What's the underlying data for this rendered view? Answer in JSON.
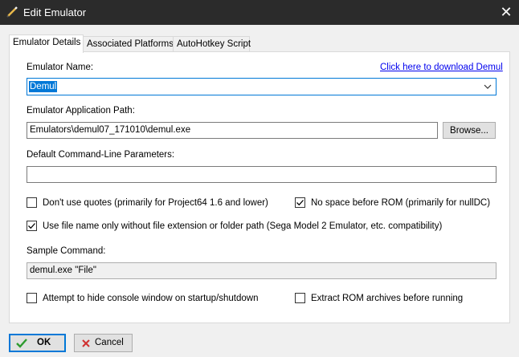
{
  "window": {
    "title": "Edit Emulator",
    "close_glyph": "✕"
  },
  "tabs": [
    {
      "label": "Emulator Details",
      "active": true
    },
    {
      "label": "Associated Platforms",
      "active": false
    },
    {
      "label": "AutoHotkey Script",
      "active": false
    }
  ],
  "details": {
    "name_label": "Emulator Name:",
    "download_link": "Click here to download Demul",
    "name_value": "Demul",
    "path_label": "Emulator Application Path:",
    "path_value": "Emulators\\demul07_171010\\demul.exe",
    "browse_label": "Browse...",
    "params_label": "Default Command-Line Parameters:",
    "params_value": "",
    "options": {
      "no_quotes": {
        "label": "Don't use quotes (primarily for Project64 1.6 and lower)",
        "checked": false
      },
      "no_space": {
        "label": "No space before ROM (primarily for nullDC)",
        "checked": true
      },
      "file_name_only": {
        "label": "Use file name only without file extension or folder path (Sega Model 2 Emulator, etc. compatibility)",
        "checked": true
      },
      "hide_console": {
        "label": "Attempt to hide console window on startup/shutdown",
        "checked": false
      },
      "extract_rom": {
        "label": "Extract ROM archives before running",
        "checked": false
      }
    },
    "sample_label": "Sample Command:",
    "sample_value": "demul.exe \"File\""
  },
  "footer": {
    "ok_label": "OK",
    "cancel_label": "Cancel"
  },
  "colors": {
    "accent": "#0078d7",
    "ok_check": "#2e9b2e",
    "cancel_x": "#d03030",
    "link": "#0000ee"
  }
}
